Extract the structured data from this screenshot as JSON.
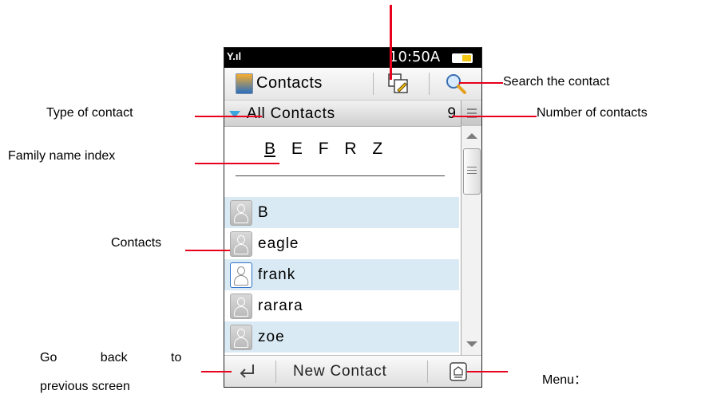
{
  "phone": {
    "status": {
      "time": "10:50A"
    },
    "toolbar": {
      "title": "Contacts"
    },
    "filter": {
      "label": "All Contacts",
      "count": "9"
    },
    "index_letters": [
      "B",
      "E",
      "F",
      "R",
      "Z"
    ],
    "contacts": [
      {
        "name": "B"
      },
      {
        "name": "eagle"
      },
      {
        "name": "frank"
      },
      {
        "name": "rarara"
      },
      {
        "name": "zoe"
      }
    ],
    "bottom": {
      "new_contact": "New Contact"
    }
  },
  "annotations": {
    "search": "Search the contact",
    "type": "Type of contact",
    "number": "Number of contacts",
    "family": "Family name index",
    "contacts": "Contacts",
    "back_line1": "Go back to",
    "back_line2": "previous screen",
    "menu": "Menu："
  },
  "colors": {
    "annotation_line": "#e8001c",
    "row_highlight": "#daeaf4",
    "accent": "#39a7e0"
  },
  "icons": [
    "signal-icon",
    "battery-icon",
    "contacts-app-icon",
    "edit-icon",
    "search-icon",
    "dropdown-arrow-icon",
    "avatar-icon",
    "back-icon",
    "menu-icon"
  ]
}
